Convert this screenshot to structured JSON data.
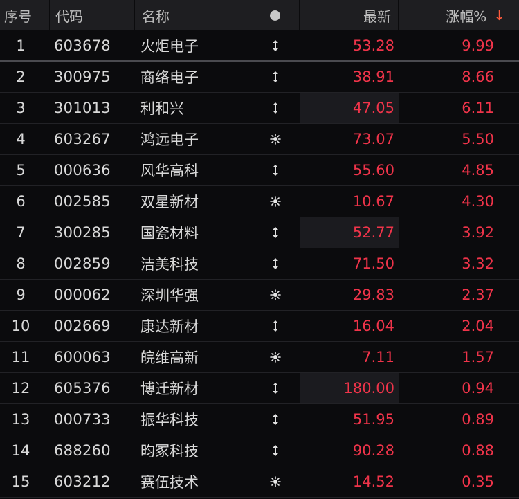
{
  "header": {
    "seq": "序号",
    "code": "代码",
    "name": "名称",
    "last": "最新",
    "pct": "涨幅%",
    "sort_arrow": "↓"
  },
  "rows": [
    {
      "seq": "1",
      "code": "603678",
      "name": "火炬电子",
      "icon": "updown-icon",
      "last": "53.28",
      "pct": "9.99"
    },
    {
      "seq": "2",
      "code": "300975",
      "name": "商络电子",
      "icon": "updown-icon",
      "last": "38.91",
      "pct": "8.66"
    },
    {
      "seq": "3",
      "code": "301013",
      "name": "利和兴",
      "icon": "updown-icon",
      "last": "47.05",
      "pct": "6.11"
    },
    {
      "seq": "4",
      "code": "603267",
      "name": "鸿远电子",
      "icon": "sun-icon",
      "last": "73.07",
      "pct": "5.50"
    },
    {
      "seq": "5",
      "code": "000636",
      "name": "风华高科",
      "icon": "updown-icon",
      "last": "55.60",
      "pct": "4.85"
    },
    {
      "seq": "6",
      "code": "002585",
      "name": "双星新材",
      "icon": "sun-icon",
      "last": "10.67",
      "pct": "4.30"
    },
    {
      "seq": "7",
      "code": "300285",
      "name": "国瓷材料",
      "icon": "updown-icon",
      "last": "52.77",
      "pct": "3.92"
    },
    {
      "seq": "8",
      "code": "002859",
      "name": "洁美科技",
      "icon": "updown-icon",
      "last": "71.50",
      "pct": "3.32"
    },
    {
      "seq": "9",
      "code": "000062",
      "name": "深圳华强",
      "icon": "sun-icon",
      "last": "29.83",
      "pct": "2.37"
    },
    {
      "seq": "10",
      "code": "002669",
      "name": "康达新材",
      "icon": "updown-icon",
      "last": "16.04",
      "pct": "2.04"
    },
    {
      "seq": "11",
      "code": "600063",
      "name": "皖维高新",
      "icon": "sun-icon",
      "last": "7.11",
      "pct": "1.57"
    },
    {
      "seq": "12",
      "code": "605376",
      "name": "博迁新材",
      "icon": "updown-icon",
      "last": "180.00",
      "pct": "0.94"
    },
    {
      "seq": "13",
      "code": "000733",
      "name": "振华科技",
      "icon": "updown-icon",
      "last": "51.95",
      "pct": "0.89"
    },
    {
      "seq": "14",
      "code": "688260",
      "name": "昀冢科技",
      "icon": "updown-icon",
      "last": "90.28",
      "pct": "0.88"
    },
    {
      "seq": "15",
      "code": "603212",
      "name": "赛伍技术",
      "icon": "sun-icon",
      "last": "14.52",
      "pct": "0.35"
    }
  ],
  "highlighted_last_rows": [
    2,
    6,
    11
  ],
  "colors": {
    "up": "#f0344a",
    "header_bg": "#1e1e21",
    "background": "#0b0b0d",
    "sort_arrow": "#ff5a3c"
  }
}
